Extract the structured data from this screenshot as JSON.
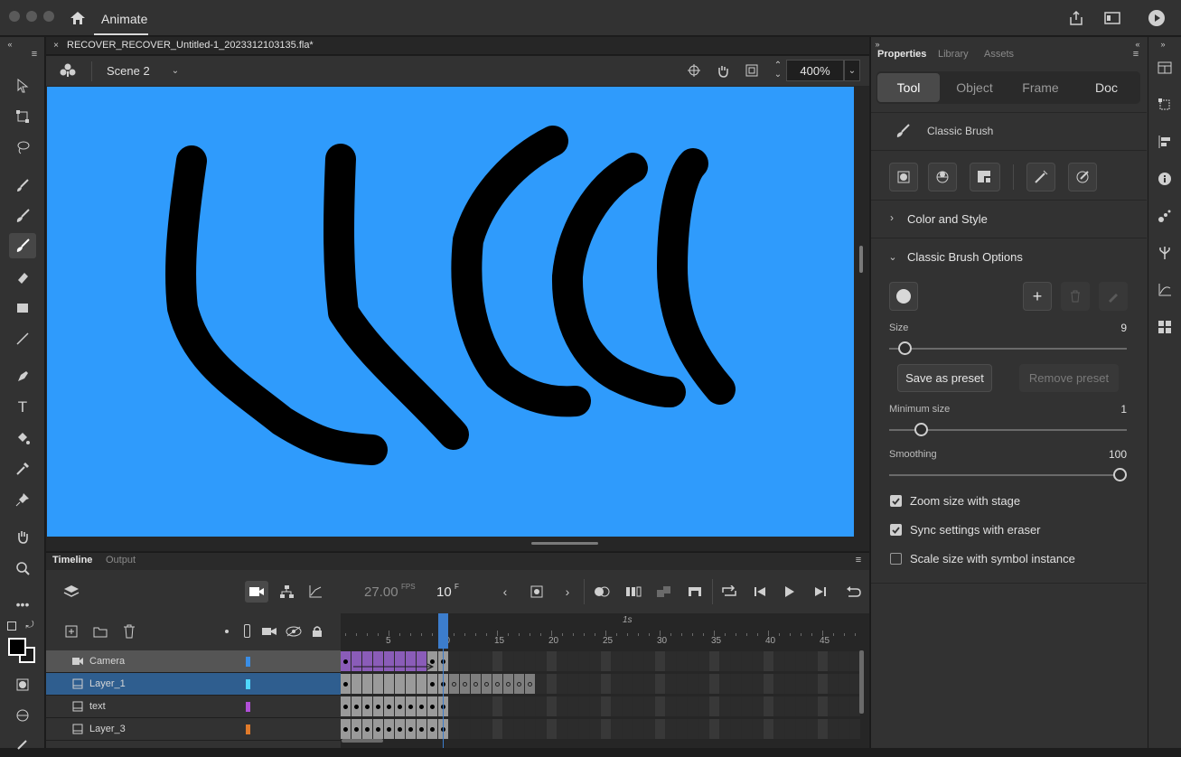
{
  "app": {
    "name": "Animate"
  },
  "document": {
    "tab_title": "RECOVER_RECOVER_Untitled-1_2023312103135.fla*",
    "scene": "Scene 2",
    "zoom": "400%"
  },
  "stage": {
    "background": "#2f9bfc",
    "stroke_color": "#000000"
  },
  "timeline": {
    "tabs": [
      "Timeline",
      "Output"
    ],
    "fps_value": "27.00",
    "fps_unit": "FPS",
    "frame_value": "10",
    "frame_unit": "F",
    "ruler_marker": "1s",
    "ruler_ticks": [
      "5",
      "10",
      "15",
      "20",
      "25",
      "30",
      "35",
      "40",
      "45"
    ],
    "layers": [
      {
        "name": "Camera",
        "color": "#3a8ee6"
      },
      {
        "name": "Layer_1",
        "color": "#4fd8ff"
      },
      {
        "name": "text",
        "color": "#b14fd8"
      },
      {
        "name": "Layer_3",
        "color": "#e07a2a"
      }
    ]
  },
  "properties": {
    "tabs": [
      "Properties",
      "Library",
      "Assets"
    ],
    "segments": [
      "Tool",
      "Object",
      "Frame",
      "Doc"
    ],
    "tool_name": "Classic Brush",
    "sections": {
      "color_style": "Color and Style",
      "brush_options": "Classic Brush Options"
    },
    "size": {
      "label": "Size",
      "value": "9",
      "fraction": 0.03
    },
    "save_preset": "Save as preset",
    "remove_preset": "Remove preset",
    "min_size": {
      "label": "Minimum size",
      "value": "1",
      "fraction": 0.14
    },
    "smoothing": {
      "label": "Smoothing",
      "value": "100",
      "fraction": 1.0
    },
    "checkboxes": [
      {
        "label": "Zoom size with stage",
        "checked": true
      },
      {
        "label": "Sync settings with eraser",
        "checked": true
      },
      {
        "label": "Scale size with symbol instance",
        "checked": false
      }
    ]
  },
  "colors": {
    "accent": "#2f6eb4",
    "panel": "#323232",
    "camera_tween": "#8a5cb8"
  }
}
